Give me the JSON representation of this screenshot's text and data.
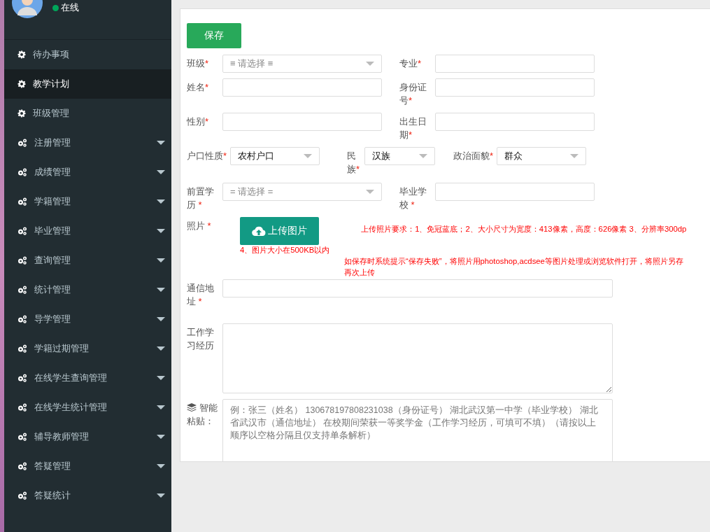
{
  "sidebar": {
    "status": "在线",
    "items": [
      {
        "kind": "link",
        "label": "待办事项",
        "selected": false
      },
      {
        "kind": "link",
        "label": "教学计划",
        "selected": true
      },
      {
        "kind": "link",
        "label": "班级管理",
        "selected": false
      },
      {
        "kind": "menu",
        "label": "注册管理",
        "selected": false
      },
      {
        "kind": "menu",
        "label": "成绩管理",
        "selected": false
      },
      {
        "kind": "menu",
        "label": "学籍管理",
        "selected": false
      },
      {
        "kind": "menu",
        "label": "毕业管理",
        "selected": false
      },
      {
        "kind": "menu",
        "label": "查询管理",
        "selected": false
      },
      {
        "kind": "menu",
        "label": "统计管理",
        "selected": false
      },
      {
        "kind": "menu",
        "label": "导学管理",
        "selected": false
      },
      {
        "kind": "menu",
        "label": "学籍过期管理",
        "selected": false
      },
      {
        "kind": "menu",
        "label": "在线学生查询管理",
        "selected": false
      },
      {
        "kind": "menu",
        "label": "在线学生统计管理",
        "selected": false
      },
      {
        "kind": "menu",
        "label": "辅导教师管理",
        "selected": false
      },
      {
        "kind": "menu",
        "label": "答疑管理",
        "selected": false
      },
      {
        "kind": "menu",
        "label": "答疑统计",
        "selected": false
      }
    ]
  },
  "form": {
    "save_button": "保存",
    "rows": [
      {
        "cells": [
          {
            "label": "班级",
            "star": "*",
            "kind": "select",
            "placeholder": "≡ 请选择 ≡"
          },
          {
            "label": "专业",
            "star": "*",
            "kind": "input"
          }
        ]
      },
      {
        "cells": [
          {
            "label": "姓名",
            "star": "*",
            "kind": "input"
          },
          {
            "label": "身份证号",
            "star": "*",
            "kind": "input"
          }
        ]
      },
      {
        "cells": [
          {
            "label": "性别",
            "star": "*",
            "kind": "input"
          },
          {
            "label": "出生日期",
            "star": "*",
            "kind": "input"
          }
        ]
      },
      {
        "cells": [
          {
            "label": "户口性质",
            "star": "*",
            "kind": "select",
            "value": "农村户口"
          },
          {
            "label": "民族",
            "star": "*",
            "kind": "select",
            "value": "汉族"
          },
          {
            "label": "政治面貌",
            "star": "*",
            "kind": "select",
            "value": "群众"
          }
        ]
      },
      {
        "cells": [
          {
            "label": "前置学历",
            "star": " *",
            "kind": "select",
            "placeholder": "= 请选择 ="
          },
          {
            "label": "毕业学校",
            "star": " *",
            "kind": "input"
          }
        ]
      }
    ],
    "photo": {
      "label": "照片",
      "star": " *",
      "button": "上传图片",
      "requirement": "上传照片要求：1、免冠蓝底；2、大小尺寸为宽度：413像素，高度：626像素 3、分辨率300dp",
      "size_note": "4、图片大小在500KB以内",
      "notice_lines": [
        "如保存时系统提示“保存失败”，将照片用photoshop,acdsee等图片处理或浏览软件打开，将照片另存",
        "再次上传"
      ]
    },
    "address": {
      "label": "通信地址",
      "star": " *"
    },
    "history": {
      "label": "工作学习经历"
    },
    "smart_paste": {
      "label": "智能粘贴：",
      "placeholder": "例：张三（姓名） 130678197808231038（身份证号） 湖北武汉第一中学（毕业学校） 湖北省武汉市（通信地址） 在校期间荣获一等奖学金（工作学习经历，可填可不填）（请按以上顺序以空格分隔且仅支持单条解析）"
    }
  }
}
